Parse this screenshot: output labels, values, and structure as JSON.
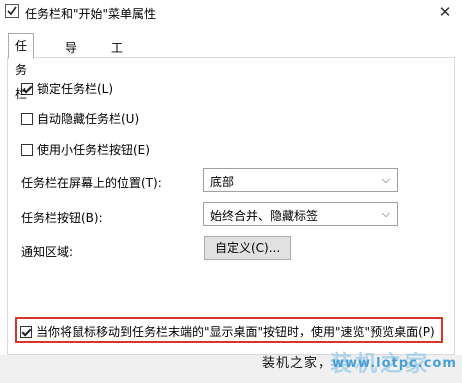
{
  "window": {
    "title": "任务栏和\"开始\"菜单属性",
    "close_label": "✕"
  },
  "tabs": [
    {
      "label": "任务栏",
      "active": true
    },
    {
      "label": "导航",
      "active": false
    },
    {
      "label": "工具栏",
      "active": false
    }
  ],
  "options": {
    "lock_taskbar": {
      "label": "锁定任务栏(L)",
      "checked": true
    },
    "auto_hide": {
      "label": "自动隐藏任务栏(U)",
      "checked": false
    },
    "small_buttons": {
      "label": "使用小任务栏按钮(E)",
      "checked": false
    }
  },
  "location": {
    "label": "任务栏在屏幕上的位置(T):",
    "value": "底部"
  },
  "buttons": {
    "label": "任务栏按钮(B):",
    "value": "始终合并、隐藏标签"
  },
  "notification": {
    "label": "通知区域:",
    "button": "自定义(C)..."
  },
  "peek": {
    "label": "当你将鼠标移动到任务栏末端的\"显示桌面\"按钮时，使用\"速览\"预览桌面(P)",
    "checked": true
  },
  "watermark": {
    "prefix": "装机之家，",
    "site": "www.lotpc.com",
    "logo_text": "装机之家"
  },
  "colors": {
    "highlight": "#d9352a",
    "brand": "#4a9fd5"
  }
}
